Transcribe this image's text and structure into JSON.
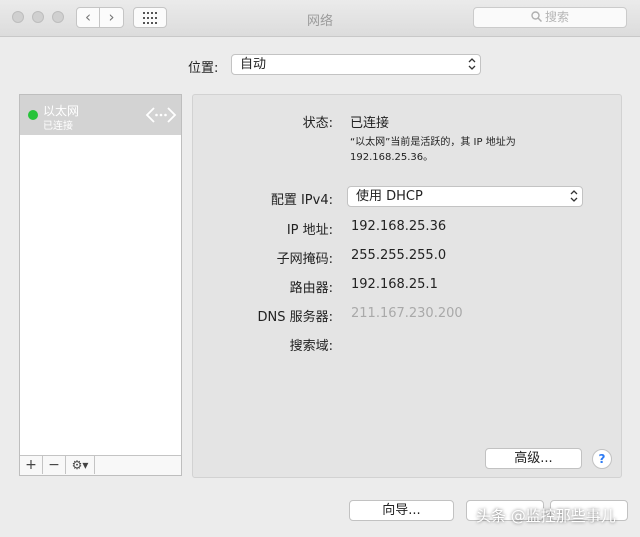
{
  "window": {
    "title": "网络"
  },
  "toolbar": {
    "back_glyph": "‹",
    "forward_glyph": "›",
    "search_placeholder": "搜索"
  },
  "location": {
    "label": "位置:",
    "value": "自动"
  },
  "services": [
    {
      "name": "以太网",
      "status": "已连接",
      "status_color": "#27c33a"
    }
  ],
  "sidebar_tools": {
    "add": "+",
    "remove": "−",
    "gear": "⚙︎▾"
  },
  "detail": {
    "status_label": "状态:",
    "status_value": "已连接",
    "status_desc_1": "“以太网”当前是活跃的，其 IP 地址为",
    "status_desc_2": "192.168.25.36。",
    "ipv4_label": "配置 IPv4:",
    "ipv4_value": "使用 DHCP",
    "ip_label": "IP 地址:",
    "ip_value": "192.168.25.36",
    "mask_label": "子网掩码:",
    "mask_value": "255.255.255.0",
    "router_label": "路由器:",
    "router_value": "192.168.25.1",
    "dns_label": "DNS 服务器:",
    "dns_value": "211.167.230.200",
    "search_domain_label": "搜索域:",
    "advanced_button": "高级...",
    "help_button": "?"
  },
  "footer": {
    "assistant_button": "向导..."
  },
  "watermark": "头条 @监控那些事儿"
}
